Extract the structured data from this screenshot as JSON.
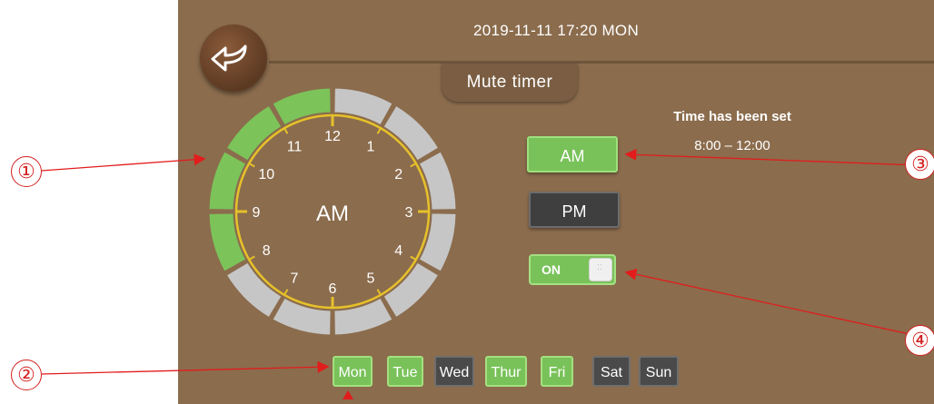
{
  "header": {
    "datetime": "2019-11-11 17:20 MON",
    "title": "Mute timer"
  },
  "clock": {
    "period_label": "AM",
    "numbers": [
      "12",
      "1",
      "2",
      "3",
      "4",
      "5",
      "6",
      "7",
      "8",
      "9",
      "10",
      "11"
    ],
    "active_color": "#7cc35a",
    "inactive_color": "#c6c6c6",
    "dial_color": "#e6c12a"
  },
  "status": {
    "label": "Time has been set",
    "range": "8:00 – 12:00"
  },
  "buttons": {
    "am": "AM",
    "pm": "PM",
    "toggle": "ON"
  },
  "days": [
    {
      "label": "Mon",
      "active": true
    },
    {
      "label": "Tue",
      "active": true
    },
    {
      "label": "Wed",
      "active": false
    },
    {
      "label": "Thur",
      "active": true
    },
    {
      "label": "Fri",
      "active": true
    },
    {
      "label": "Sat",
      "active": false
    },
    {
      "label": "Sun",
      "active": false
    }
  ],
  "annotations": {
    "c1": "①",
    "c2": "②",
    "c3": "③",
    "c4": "④"
  },
  "icons": {
    "back": "back-arrow-icon"
  }
}
